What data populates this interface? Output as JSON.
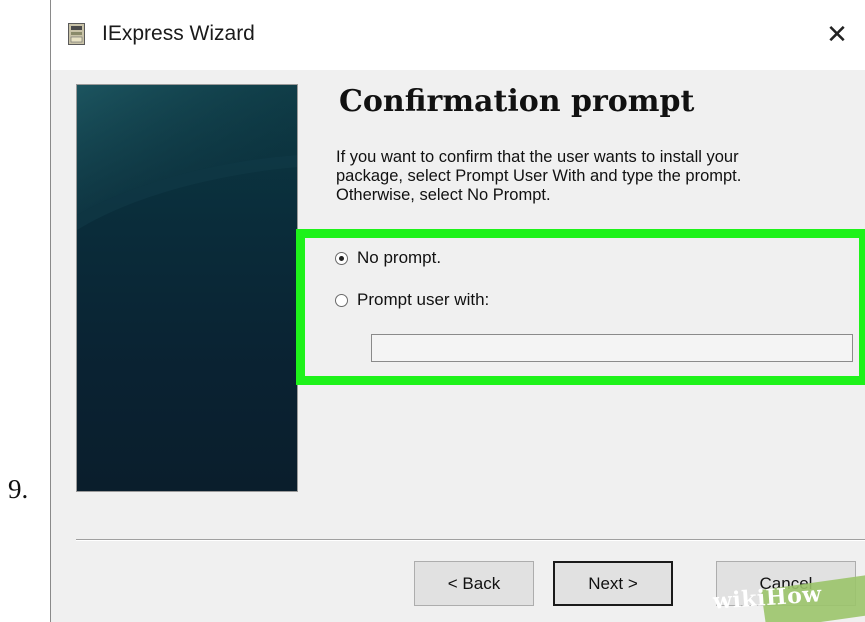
{
  "step": {
    "number": "9."
  },
  "window": {
    "title": "IExpress Wizard",
    "close_icon": "close-icon",
    "app_icon": "iexpress-app-icon"
  },
  "page": {
    "heading": "Confirmation prompt",
    "description_lines": [
      "If you want to confirm that the user wants to install your",
      "package, select Prompt User With and type the prompt.",
      "Otherwise, select No Prompt."
    ]
  },
  "options": {
    "no_prompt": {
      "label": "No prompt.",
      "checked": true
    },
    "prompt_user": {
      "label": "Prompt user with:",
      "checked": false
    },
    "prompt_text": {
      "value": "",
      "placeholder": ""
    }
  },
  "buttons": {
    "back": "< Back",
    "next": "Next >",
    "cancel": "Cancel"
  },
  "watermark": {
    "text": "wikiHow"
  },
  "colors": {
    "highlight": "#1ef21a",
    "side_panel": "#0a2a38",
    "window_bg": "#f0f0f0",
    "watermark_bg": "#9bc46a"
  }
}
